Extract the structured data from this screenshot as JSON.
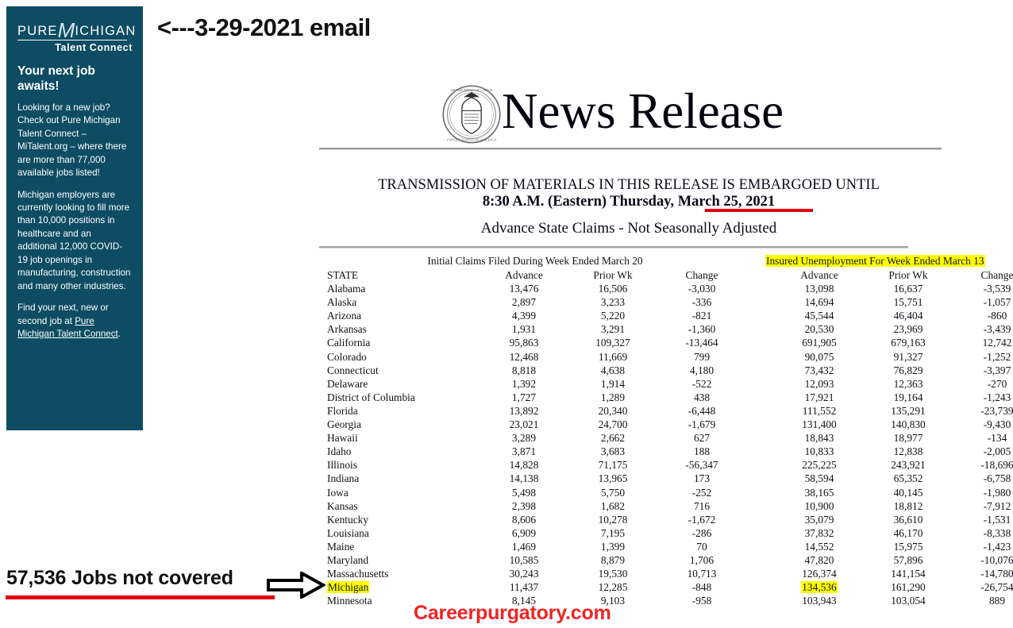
{
  "annotations": {
    "email_note": "<---3-29-2021 email",
    "jobs_note": "57,536 Jobs not covered",
    "site_note": "Careerpurgatory.com",
    "accent_red": "#e3000f",
    "highlight_yellow": "#ffff00",
    "site_red": "#ef2424"
  },
  "sidebar": {
    "brand_color": "#0d4c63",
    "logo": {
      "part1": "PURE",
      "part_m": "M",
      "part2": "ICHIGAN",
      "tagline": "Talent Connect"
    },
    "heading": "Your next job awaits!",
    "paragraphs": [
      "Looking for a new job? Check out Pure Michigan Talent Connect – MiTalent.org – where there are more than 77,000 available jobs listed!",
      "Michigan employers are currently looking to fill more than 10,000 positions in healthcare and an additional 12,000 COVID-19 job openings in manufacturing, construction and many other industries."
    ],
    "closing_prefix": "Find your next, new or second job at ",
    "closing_link": "Pure Michigan Talent Connect",
    "closing_suffix": "."
  },
  "document": {
    "seal_icon": "dol-seal-icon",
    "title": "News Release",
    "embargo_line1": "TRANSMISSION OF MATERIALS IN THIS RELEASE IS EMBARGOED UNTIL",
    "embargo_line2_prefix": "8:30 A.M. (Eastern) Thursday, ",
    "embargo_date": "March 25, 2021",
    "subtitle": "Advance State Claims - Not Seasonally Adjusted"
  },
  "table": {
    "group_left": "Initial Claims Filed During Week Ended March 20",
    "group_right": "Insured Unemployment For Week Ended March 13",
    "columns": [
      "STATE",
      "Advance",
      "Prior Wk",
      "Change",
      "Advance",
      "Prior Wk",
      "Change"
    ],
    "highlight_state": "Michigan",
    "rows": [
      {
        "state": "Alabama",
        "ic_adv": "13,476",
        "ic_prior": "16,506",
        "ic_chg": "-3,030",
        "iu_adv": "13,098",
        "iu_prior": "16,637",
        "iu_chg": "-3,539"
      },
      {
        "state": "Alaska",
        "ic_adv": "2,897",
        "ic_prior": "3,233",
        "ic_chg": "-336",
        "iu_adv": "14,694",
        "iu_prior": "15,751",
        "iu_chg": "-1,057"
      },
      {
        "state": "Arizona",
        "ic_adv": "4,399",
        "ic_prior": "5,220",
        "ic_chg": "-821",
        "iu_adv": "45,544",
        "iu_prior": "46,404",
        "iu_chg": "-860"
      },
      {
        "state": "Arkansas",
        "ic_adv": "1,931",
        "ic_prior": "3,291",
        "ic_chg": "-1,360",
        "iu_adv": "20,530",
        "iu_prior": "23,969",
        "iu_chg": "-3,439"
      },
      {
        "state": "California",
        "ic_adv": "95,863",
        "ic_prior": "109,327",
        "ic_chg": "-13,464",
        "iu_adv": "691,905",
        "iu_prior": "679,163",
        "iu_chg": "12,742"
      },
      {
        "state": "Colorado",
        "ic_adv": "12,468",
        "ic_prior": "11,669",
        "ic_chg": "799",
        "iu_adv": "90,075",
        "iu_prior": "91,327",
        "iu_chg": "-1,252"
      },
      {
        "state": "Connecticut",
        "ic_adv": "8,818",
        "ic_prior": "4,638",
        "ic_chg": "4,180",
        "iu_adv": "73,432",
        "iu_prior": "76,829",
        "iu_chg": "-3,397"
      },
      {
        "state": "Delaware",
        "ic_adv": "1,392",
        "ic_prior": "1,914",
        "ic_chg": "-522",
        "iu_adv": "12,093",
        "iu_prior": "12,363",
        "iu_chg": "-270"
      },
      {
        "state": "District of Columbia",
        "ic_adv": "1,727",
        "ic_prior": "1,289",
        "ic_chg": "438",
        "iu_adv": "17,921",
        "iu_prior": "19,164",
        "iu_chg": "-1,243"
      },
      {
        "state": "Florida",
        "ic_adv": "13,892",
        "ic_prior": "20,340",
        "ic_chg": "-6,448",
        "iu_adv": "111,552",
        "iu_prior": "135,291",
        "iu_chg": "-23,739"
      },
      {
        "state": "Georgia",
        "ic_adv": "23,021",
        "ic_prior": "24,700",
        "ic_chg": "-1,679",
        "iu_adv": "131,400",
        "iu_prior": "140,830",
        "iu_chg": "-9,430"
      },
      {
        "state": "Hawaii",
        "ic_adv": "3,289",
        "ic_prior": "2,662",
        "ic_chg": "627",
        "iu_adv": "18,843",
        "iu_prior": "18,977",
        "iu_chg": "-134"
      },
      {
        "state": "Idaho",
        "ic_adv": "3,871",
        "ic_prior": "3,683",
        "ic_chg": "188",
        "iu_adv": "10,833",
        "iu_prior": "12,838",
        "iu_chg": "-2,005"
      },
      {
        "state": "Illinois",
        "ic_adv": "14,828",
        "ic_prior": "71,175",
        "ic_chg": "-56,347",
        "iu_adv": "225,225",
        "iu_prior": "243,921",
        "iu_chg": "-18,696"
      },
      {
        "state": "Indiana",
        "ic_adv": "14,138",
        "ic_prior": "13,965",
        "ic_chg": "173",
        "iu_adv": "58,594",
        "iu_prior": "65,352",
        "iu_chg": "-6,758"
      },
      {
        "state": "Iowa",
        "ic_adv": "5,498",
        "ic_prior": "5,750",
        "ic_chg": "-252",
        "iu_adv": "38,165",
        "iu_prior": "40,145",
        "iu_chg": "-1,980"
      },
      {
        "state": "Kansas",
        "ic_adv": "2,398",
        "ic_prior": "1,682",
        "ic_chg": "716",
        "iu_adv": "10,900",
        "iu_prior": "18,812",
        "iu_chg": "-7,912"
      },
      {
        "state": "Kentucky",
        "ic_adv": "8,606",
        "ic_prior": "10,278",
        "ic_chg": "-1,672",
        "iu_adv": "35,079",
        "iu_prior": "36,610",
        "iu_chg": "-1,531"
      },
      {
        "state": "Louisiana",
        "ic_adv": "6,909",
        "ic_prior": "7,195",
        "ic_chg": "-286",
        "iu_adv": "37,832",
        "iu_prior": "46,170",
        "iu_chg": "-8,338"
      },
      {
        "state": "Maine",
        "ic_adv": "1,469",
        "ic_prior": "1,399",
        "ic_chg": "70",
        "iu_adv": "14,552",
        "iu_prior": "15,975",
        "iu_chg": "-1,423"
      },
      {
        "state": "Maryland",
        "ic_adv": "10,585",
        "ic_prior": "8,879",
        "ic_chg": "1,706",
        "iu_adv": "47,820",
        "iu_prior": "57,896",
        "iu_chg": "-10,076"
      },
      {
        "state": "Massachusetts",
        "ic_adv": "30,243",
        "ic_prior": "19,530",
        "ic_chg": "10,713",
        "iu_adv": "126,374",
        "iu_prior": "141,154",
        "iu_chg": "-14,780"
      },
      {
        "state": "Michigan",
        "ic_adv": "11,437",
        "ic_prior": "12,285",
        "ic_chg": "-848",
        "iu_adv": "134,536",
        "iu_prior": "161,290",
        "iu_chg": "-26,754"
      },
      {
        "state": "Minnesota",
        "ic_adv": "8,145",
        "ic_prior": "9,103",
        "ic_chg": "-958",
        "iu_adv": "103,943",
        "iu_prior": "103,054",
        "iu_chg": "889"
      }
    ]
  }
}
